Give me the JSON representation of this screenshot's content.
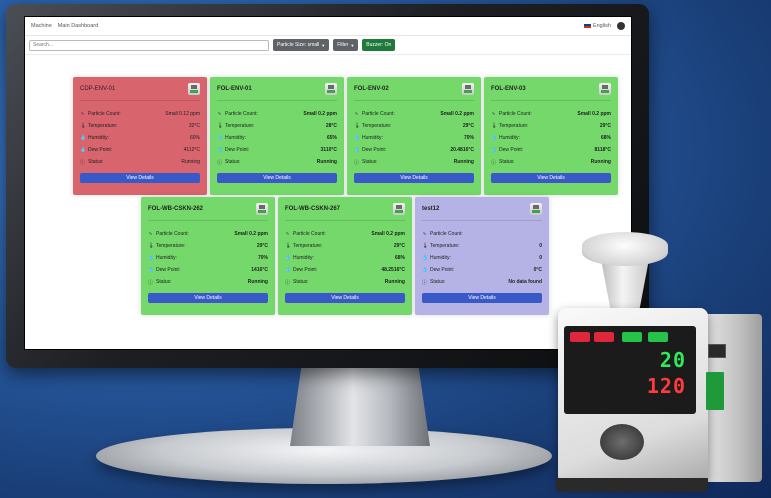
{
  "topbar": {
    "breadcrumbs": [
      "Machine",
      "Main Dashboard"
    ],
    "language": "English"
  },
  "toolbar": {
    "search_placeholder": "Search...",
    "particle_size_label": "Particle Size: small",
    "filter_label": "Filter",
    "buzzer_label": "Buzzer: On"
  },
  "labels": {
    "particle_count": "Particle Count:",
    "temperature": "Temperature:",
    "humidity": "Humidity:",
    "dew_point": "Dew Point:",
    "status": "Status:",
    "view_details": "View Details"
  },
  "cards": [
    {
      "name": "CDP-ENV-01",
      "particle_count": "Small 0.12 ppm",
      "temperature": "32°C",
      "humidity": "60%",
      "dew_point": "4112°C",
      "status": "Running",
      "state": "alarm",
      "color": "#d8646e"
    },
    {
      "name": "FOL-ENV-01",
      "particle_count": "Small 0.2 ppm",
      "temperature": "28°C",
      "humidity": "65%",
      "dew_point": "3110°C",
      "status": "Running",
      "state": "ok",
      "color": "#74d96a"
    },
    {
      "name": "FOL-ENV-02",
      "particle_count": "Small 0.2 ppm",
      "temperature": "29°C",
      "humidity": "70%",
      "dew_point": "20.4816°C",
      "status": "Running",
      "state": "ok",
      "color": "#74d96a"
    },
    {
      "name": "FOL-ENV-03",
      "particle_count": "Small 0.2 ppm",
      "temperature": "29°C",
      "humidity": "68%",
      "dew_point": "8118°C",
      "status": "Running",
      "state": "ok",
      "color": "#74d96a"
    },
    {
      "name": "FOL-WB-CSKN-262",
      "particle_count": "Small 0.2 ppm",
      "temperature": "29°C",
      "humidity": "70%",
      "dew_point": "1416°C",
      "status": "Running",
      "state": "ok",
      "color": "#74d96a"
    },
    {
      "name": "FOL-WB-CSKN-267",
      "particle_count": "Small 0.2 ppm",
      "temperature": "29°C",
      "humidity": "68%",
      "dew_point": "48.2516°C",
      "status": "Running",
      "state": "ok",
      "color": "#74d96a"
    },
    {
      "name": "test12",
      "particle_count": "",
      "temperature": "0",
      "humidity": "0",
      "dew_point": "0°C",
      "status": "No data found",
      "state": "nodata",
      "color": "#b5b3e6"
    }
  ],
  "device": {
    "display_top": "20",
    "display_bottom": "120"
  },
  "colors": {
    "alarm": "#d8646e",
    "ok": "#74d96a",
    "nodata": "#b5b3e6",
    "button": "#3a59c9",
    "buzzer": "#1e7a3b"
  }
}
